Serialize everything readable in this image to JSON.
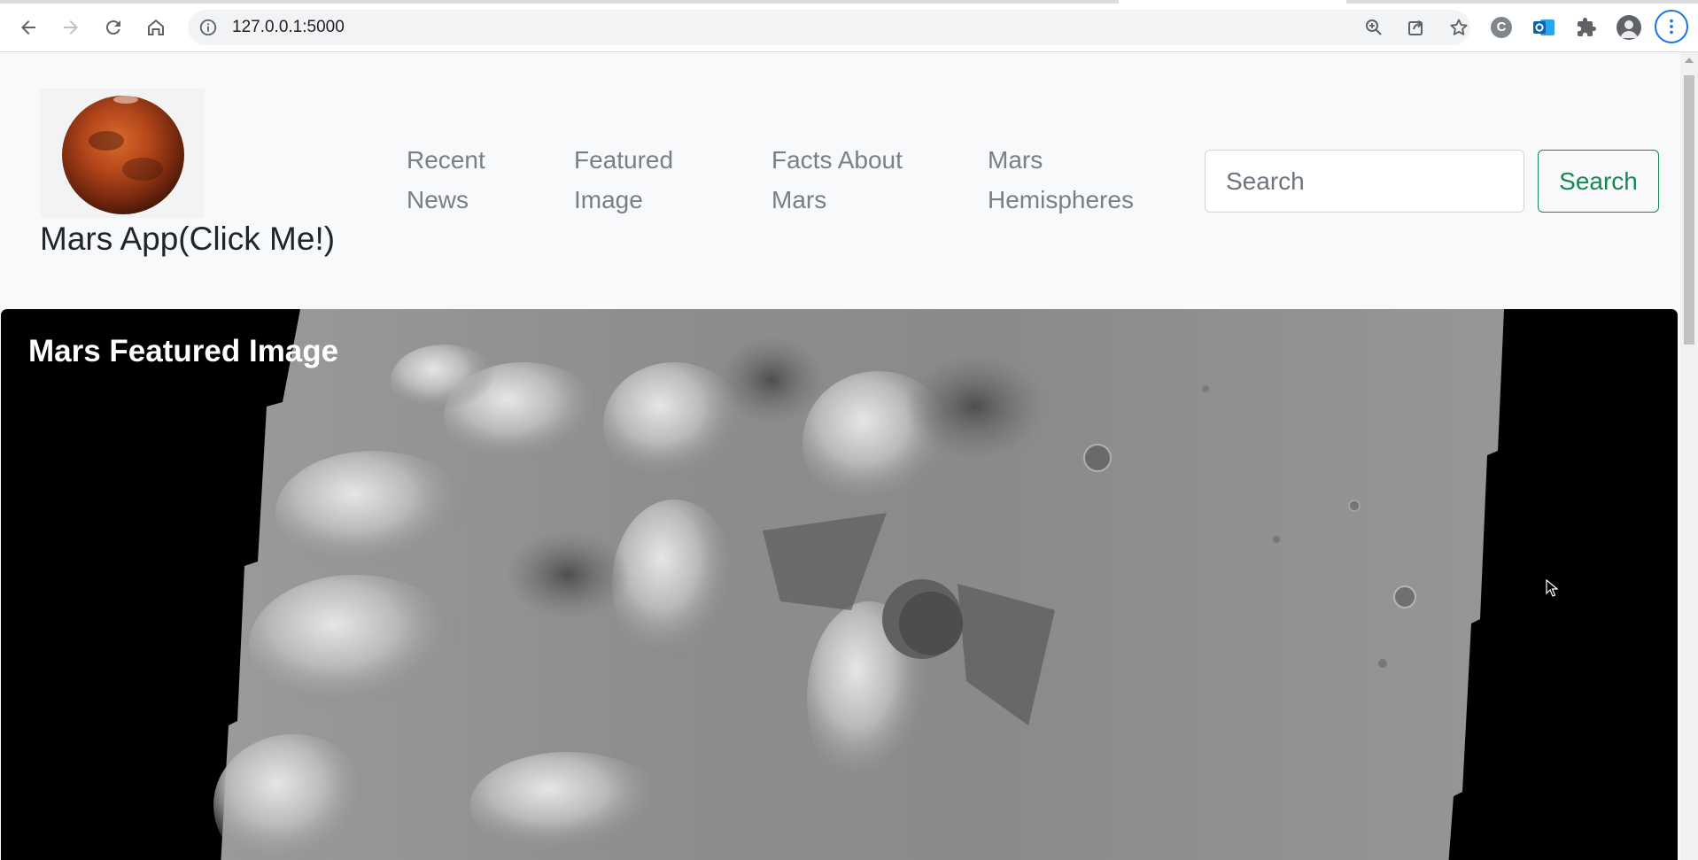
{
  "browser": {
    "url": "127.0.0.1:5000",
    "icons": [
      "back-icon",
      "forward-icon",
      "reload-icon",
      "home-icon",
      "site-info-icon",
      "zoom-icon",
      "share-icon",
      "bookmark-star-icon",
      "extension-c-icon",
      "outlook-icon",
      "extensions-puzzle-icon",
      "profile-icon",
      "chrome-menu-icon"
    ],
    "extension_c_letter": "C"
  },
  "navbar": {
    "brand": "Mars App(Click Me!)",
    "links": [
      {
        "line1": "Recent",
        "line2": "News"
      },
      {
        "line1": "Featured",
        "line2": "Image"
      },
      {
        "line1": "Facts About",
        "line2": "Mars"
      },
      {
        "line1": "Mars",
        "line2": "Hemispheres"
      }
    ],
    "search": {
      "placeholder": "Search",
      "value": "",
      "button_label": "Search"
    }
  },
  "featured": {
    "title": "Mars Featured Image"
  },
  "colors": {
    "navbar_bg": "#f8f9fa",
    "nav_link": "#7b7f84",
    "search_button": "#198754",
    "featured_bg": "#000000"
  }
}
